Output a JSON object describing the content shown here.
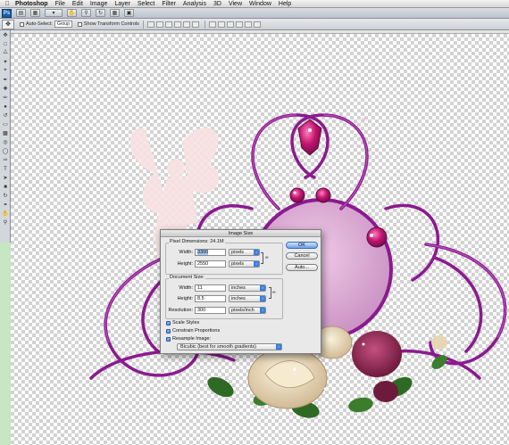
{
  "menubar": {
    "apple": "",
    "app_name": "Photoshop",
    "items": [
      "File",
      "Edit",
      "Image",
      "Layer",
      "Select",
      "Filter",
      "Analysis",
      "3D",
      "View",
      "Window",
      "Help"
    ]
  },
  "appbar": {
    "logo": "Ps"
  },
  "options_bar": {
    "auto_select_label": "Auto-Select:",
    "auto_select_value": "Group",
    "show_transform_label": "Show Transform Controls"
  },
  "dialog": {
    "title": "Image Size",
    "pixel_dimensions_label": "Pixel Dimensions:",
    "pixel_dimensions_value": "24.1M",
    "pixel": {
      "width_label": "Width:",
      "width_value": "3300",
      "width_unit": "pixels",
      "height_label": "Height:",
      "height_value": "2550",
      "height_unit": "pixels"
    },
    "document_size_label": "Document Size:",
    "document": {
      "width_label": "Width:",
      "width_value": "11",
      "width_unit": "inches",
      "height_label": "Height:",
      "height_value": "8.5",
      "height_unit": "inches",
      "resolution_label": "Resolution:",
      "resolution_value": "300",
      "resolution_unit": "pixels/inch"
    },
    "scale_styles": "Scale Styles",
    "constrain_proportions": "Constrain Proportions",
    "resample_image": "Resample Image:",
    "resample_method": "Bicubic (best for smooth gradients)",
    "ok": "OK",
    "cancel": "Cancel",
    "auto": "Auto..."
  },
  "colors": {
    "accent_blue": "#3d7fd8",
    "frame_purple": "#8b1a8f",
    "jewel_magenta": "#d01f7a",
    "window_pink": "#d9a5d2"
  }
}
